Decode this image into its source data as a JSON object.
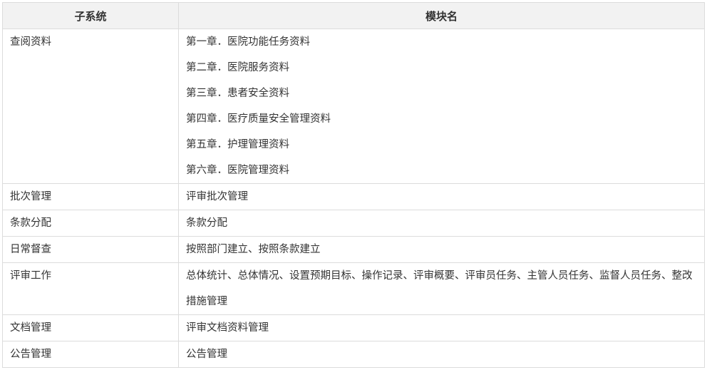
{
  "headers": [
    "子系统",
    "模块名"
  ],
  "rows": [
    {
      "subsystem": "查阅资料",
      "modules": [
        "第一章．医院功能任务资料",
        "第二章．医院服务资料",
        "第三章．患者安全资料",
        "第四章．医疗质量安全管理资料",
        "第五章．护理管理资料",
        "第六章．医院管理资料"
      ]
    },
    {
      "subsystem": "批次管理",
      "modules": [
        "评审批次管理"
      ]
    },
    {
      "subsystem": "条款分配",
      "modules": [
        "条款分配"
      ]
    },
    {
      "subsystem": "日常督查",
      "modules": [
        "按照部门建立、按照条款建立"
      ]
    },
    {
      "subsystem": "评审工作",
      "modules": [
        "总体统计、总体情况、设置预期目标、操作记录、评审概要、评审员任务、主管人员任务、监督人员任务、整改措施管理"
      ]
    },
    {
      "subsystem": "文档管理",
      "modules": [
        "评审文档资料管理"
      ]
    },
    {
      "subsystem": "公告管理",
      "modules": [
        "公告管理"
      ]
    }
  ]
}
